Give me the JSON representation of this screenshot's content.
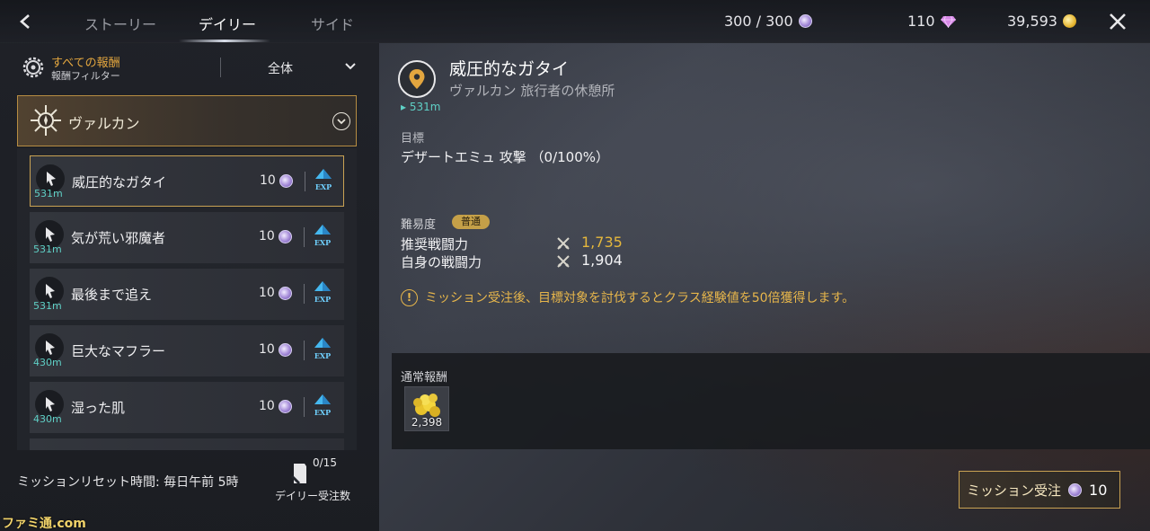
{
  "header": {
    "tabs": [
      {
        "label": "ストーリー"
      },
      {
        "label": "デイリー"
      },
      {
        "label": "サイド"
      }
    ],
    "stamina": "300  /  300",
    "gems": "110",
    "gold": "39,593"
  },
  "filter": {
    "title": "すべての報酬",
    "subtitle": "報酬フィルター",
    "value": "全体"
  },
  "region": {
    "name": "ヴァルカン"
  },
  "quests": [
    {
      "distance": "531m",
      "name": "威圧的なガタイ",
      "reward": "10"
    },
    {
      "distance": "531m",
      "name": "気が荒い邪魔者",
      "reward": "10"
    },
    {
      "distance": "531m",
      "name": "最後まで追え",
      "reward": "10"
    },
    {
      "distance": "430m",
      "name": "巨大なマフラー",
      "reward": "10"
    },
    {
      "distance": "430m",
      "name": "湿った肌",
      "reward": "10"
    }
  ],
  "exp_label": "EXP",
  "footer": {
    "reset_text": "ミッションリセット時間: 毎日午前  5時",
    "daily_count": "0/15",
    "daily_label": "デイリー受注数"
  },
  "watermark": "ファミ通.com",
  "detail": {
    "distance": "531m",
    "title": "威圧的なガタイ",
    "subtitle": "ヴァルカン 旅行者の休憩所",
    "objective_label": "目標",
    "objective_text": "デザートエミュ  攻撃 （0/100%）",
    "difficulty_label": "難易度",
    "difficulty_badge": "普通",
    "recommended_cp_label": "推奨戦闘力",
    "recommended_cp": "1,735",
    "own_cp_label": "自身の戦闘力",
    "own_cp": "1,904",
    "notice": "ミッション受注後、目標対象を討伐するとクラス経験値を50倍獲得します。",
    "reward_label": "通常報酬",
    "reward_count": "2,398"
  },
  "accept_button": {
    "label": "ミッション受注",
    "cost": "10"
  },
  "colors": {
    "accent_gold": "#c9a253",
    "distance_teal": "#5fd0c6",
    "recommended_cp": "#e5b73c",
    "notice": "#e7b64b"
  }
}
